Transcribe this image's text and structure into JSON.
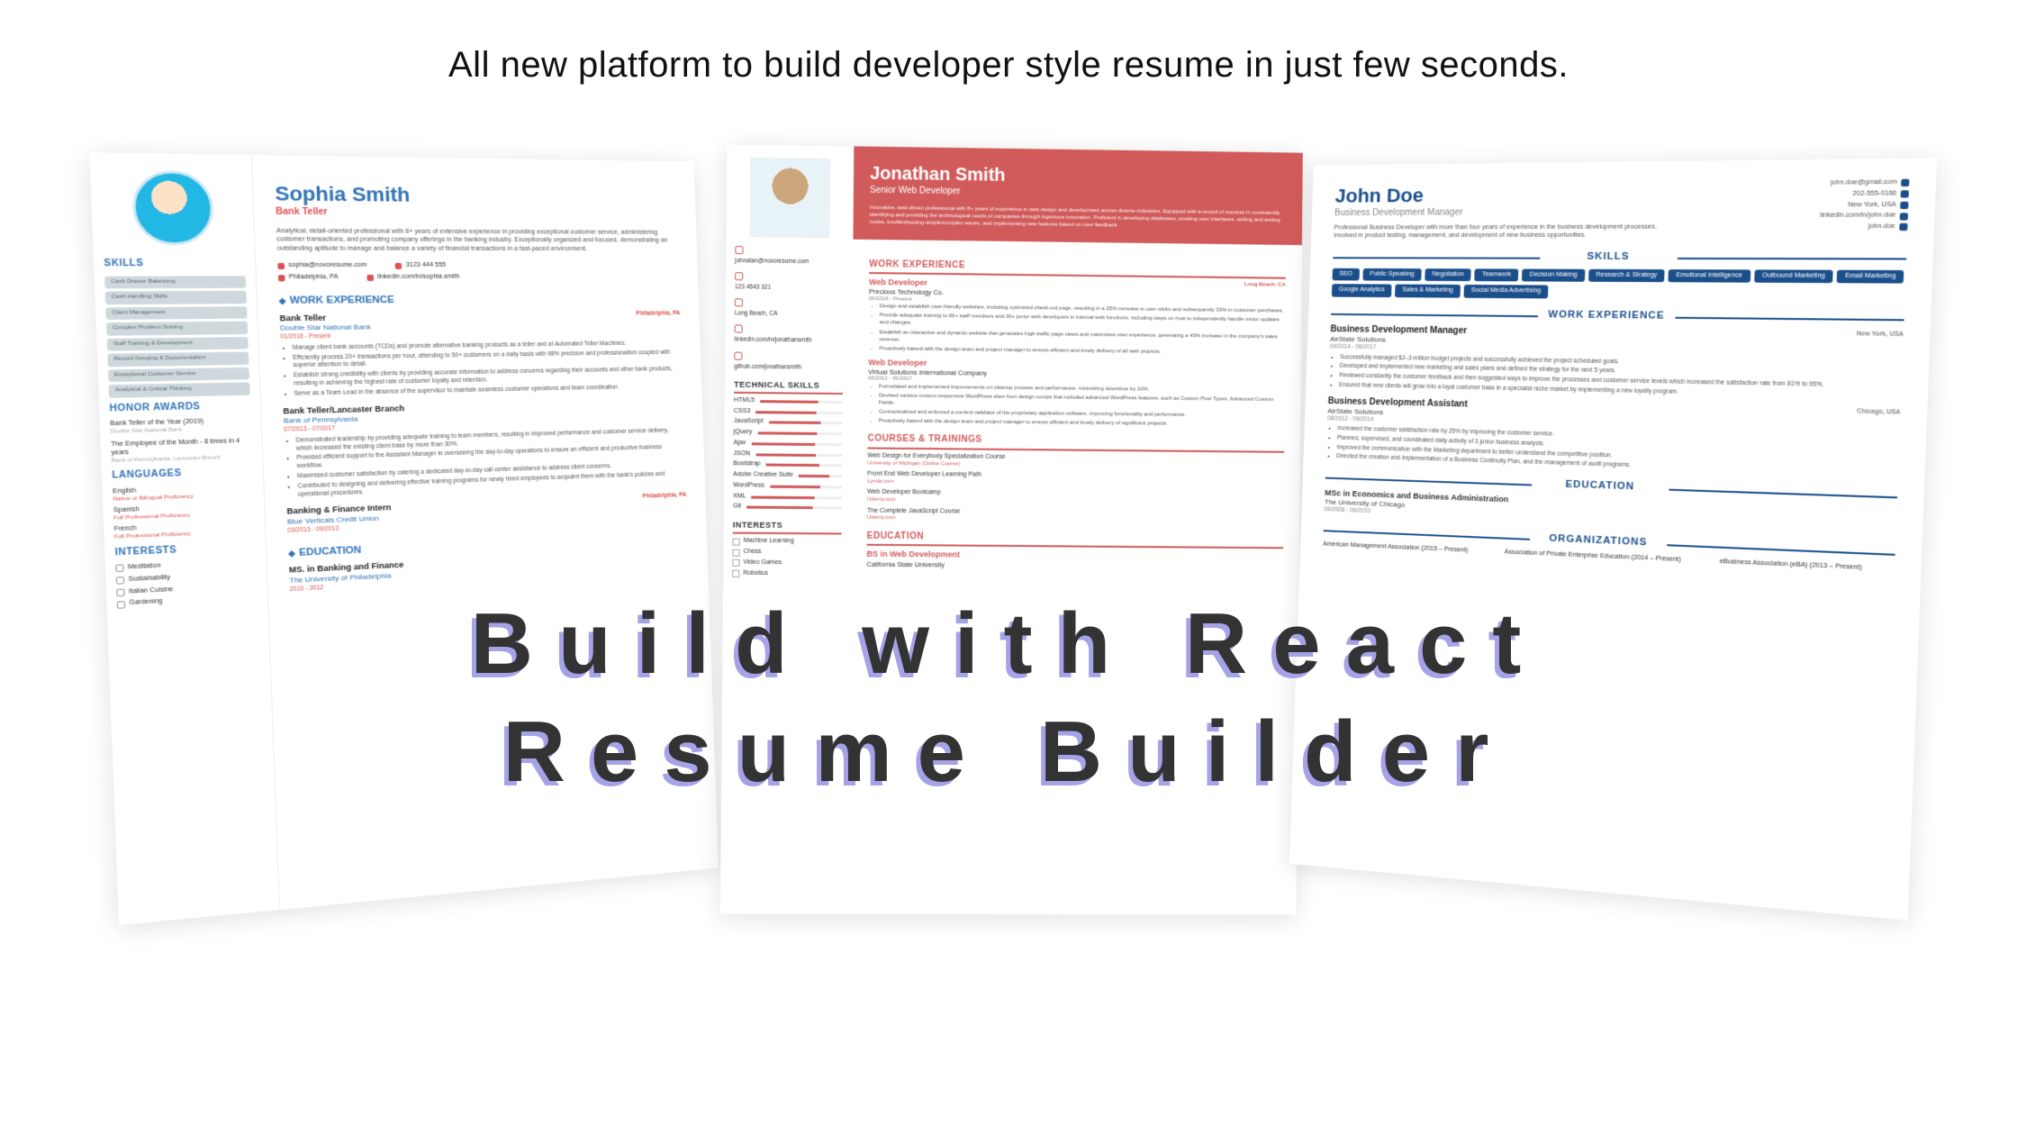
{
  "tagline": "All new platform to build developer style resume in just few seconds.",
  "hero": {
    "line1": "Build with React",
    "line2": "Resume Builder"
  },
  "card1": {
    "name": "Sophia Smith",
    "role": "Bank Teller",
    "summary": "Analytical, detail-oriented professional with 8+ years of extensive experience in providing exceptional customer service, administering customer transactions, and promoting company offerings in the banking industry. Exceptionally organized and focused, demonstrating an outstanding aptitude to manage and balance a variety of financial transactions in a fast-paced environment.",
    "contacts": {
      "email": "sophia@novoresume.com",
      "location": "Philadelphia, PA",
      "phone": "3123 444 555",
      "linkedin": "linkedin.com/in/sophia.smith"
    },
    "sections": {
      "skills_h": "SKILLS",
      "skills": [
        "Cash Drawer Balancing",
        "Cash Handling Skills",
        "Client Management",
        "Complex Problem Solving",
        "Staff Training & Development",
        "Record Keeping & Documentation",
        "Exceptional Customer Service",
        "Analytical & Critical Thinking"
      ],
      "honors_h": "HONOR AWARDS",
      "honors": [
        {
          "t": "Bank Teller of the Year (2019)",
          "s": "Double Star National Bank"
        },
        {
          "t": "The Employee of the Month - 8 times in 4 years",
          "s": "Bank of Pennsylvania, Lancaster Branch"
        }
      ],
      "lang_h": "LANGUAGES",
      "langs": [
        {
          "t": "English",
          "l": "Native or Bilingual Proficiency"
        },
        {
          "t": "Spanish",
          "l": "Full Professional Proficiency"
        },
        {
          "t": "French",
          "l": "Full Professional Proficiency"
        }
      ],
      "int_h": "INTERESTS",
      "interests": [
        "Meditation",
        "Sustainability",
        "Italian Cuisine",
        "Gardening"
      ]
    },
    "work_h": "WORK EXPERIENCE",
    "jobs": [
      {
        "title": "Bank Teller",
        "company": "Double Star National Bank",
        "dates": "01/2018 - Present",
        "loc": "Philadelphia, PA",
        "bullets": [
          "Manage client bank accounts (TCDs) and promote alternative banking products as a teller and at Automated Teller Machines.",
          "Efficiently process 20+ transactions per hour, attending to 50+ customers on a daily basis with 98% precision and professionalism coupled with superior attention to detail.",
          "Establish strong credibility with clients by providing accurate information to address concerns regarding their accounts and other bank products, resulting in achieving the highest rate of customer loyalty and retention.",
          "Serve as a Team Lead in the absence of the supervisor to maintain seamless customer operations and team coordination."
        ]
      },
      {
        "title": "Bank Teller/Lancaster Branch",
        "company": "Bank of Pennsylvania",
        "dates": "07/2013 - 07/2017",
        "bullets": [
          "Demonstrated leadership by providing adequate training to team members, resulting in improved performance and customer service delivery, which increased the existing client base by more than 30%.",
          "Provided efficient support to the Assistant Manager in overseeing the day-to-day operations to ensure an efficient and productive business workflow.",
          "Maximized customer satisfaction by catering a dedicated day-to-day call center assistance to address client concerns.",
          "Contributed to designing and delivering effective training programs for newly hired employees to acquaint them with the bank's policies and operational procedures."
        ]
      },
      {
        "title": "Banking & Finance Intern",
        "company": "Blue Verticals Credit Union",
        "dates": "03/2013 - 09/2013",
        "loc": "Philadelphia, PA",
        "bullets": []
      }
    ],
    "edu_h": "EDUCATION",
    "edu": {
      "deg": "MS. in Banking and Finance",
      "school": "The University of Philadelphia",
      "dates": "2010 - 2012"
    }
  },
  "card2": {
    "name": "Jonathan Smith",
    "role": "Senior Web Developer",
    "summary": "Innovative, task-driven professional with 8+ years of experience in web design and development across diverse industries. Equipped with a record of success in consistently identifying and providing the technological needs of companies through ingenious innovation. Proficient in developing databases, creating user interfaces, writing and testing codes, troubleshooting simple/complex issues, and implementing new features based on user feedback.",
    "contacts": {
      "email": "johnatan@novoresume.com",
      "phone": "123 4543 321",
      "location": "Long Beach, CA",
      "linkedin": "linkedin.com/in/jonathansmith",
      "github": "github.com/jonathansmith"
    },
    "tech_h": "TECHNICAL SKILLS",
    "tech": [
      "HTML5",
      "CSS3",
      "JavaScript",
      "jQuery",
      "Ajax",
      "JSON",
      "Bootstrap",
      "Adobe Creative Suite",
      "WordPress",
      "XML",
      "Git"
    ],
    "int_h": "INTERESTS",
    "interests": [
      "Machine Learning",
      "Chess",
      "Video Games",
      "Robotics"
    ],
    "work_h": "WORK EXPERIENCE",
    "jobs": [
      {
        "title": "Web Developer",
        "company": "Precious Technology Co.",
        "dates": "06/2018 - Present",
        "loc": "Long Beach, CA",
        "bullets": [
          "Design and establish user-friendly websites, including optimized check-out page, resulting in a 25% increase in user clicks and subsequently 33% in customer purchases.",
          "Provide adequate training to 60+ staff members and 30+ junior web developers in internal web functions, including steps on how to independently handle minor updates and changes.",
          "Establish an interactive and dynamic website that generates high-traffic page views and maximizes user experience, generating a 45% increase in the company's sales revenue.",
          "Proactively liaised with the design team and project manager to ensure efficient and timely delivery of all web projects."
        ]
      },
      {
        "title": "Web Developer",
        "company": "Virtual Solutions International Company",
        "dates": "06/2012 - 06/2017",
        "bullets": [
          "Formulated and implemented improvements on cleanup process and performance, minimizing downtime by 10%.",
          "Devised various custom responsive WordPress sites from design comps that included advanced WordPress features, such as Custom Post Types, Advanced Custom Fields.",
          "Conceptualized and enforced a content validator of the proprietary application software, improving functionality and performance.",
          "Proactively liaised with the design team and project manager to ensure efficient and timely delivery of significant projects."
        ]
      }
    ],
    "courses_h": "COURSES & TRAININGS",
    "courses": [
      {
        "t": "Web Design for Everybody Specialization Course",
        "s": "University of Michigan (Online Course)"
      },
      {
        "t": "Front End Web Developer Learning Path",
        "s": "Lynda.com"
      },
      {
        "t": "Web Developer Bootcamp",
        "s": "Udemy.com"
      },
      {
        "t": "The Complete JavaScript Course",
        "s": "Udemy.com"
      }
    ],
    "edu_h": "EDUCATION",
    "edu": {
      "deg": "BS in Web Development",
      "school": "California State University"
    }
  },
  "card3": {
    "name": "John Doe",
    "role": "Business Development Manager",
    "summary": "Professional Business Developer with more than four years of experience in the business development processes. Involved in product testing, management, and development of new business opportunities.",
    "contacts": {
      "email": "john.doe@gmail.com",
      "phone": "202-555-0166",
      "location": "New York, USA",
      "linkedin": "linkedin.com/in/john.doe",
      "skype": "john.doe"
    },
    "skills_h": "SKILLS",
    "skills": [
      "SEO",
      "Public Speaking",
      "Negotiation",
      "Teamwork",
      "Decision Making",
      "Research & Strategy",
      "Emotional Intelligence",
      "Outbound Marketing",
      "Email Marketing",
      "Google Analytics",
      "Sales & Marketing",
      "Social Media Advertising"
    ],
    "work_h": "WORK EXPERIENCE",
    "jobs": [
      {
        "title": "Business Development Manager",
        "company": "AirState Solutions",
        "dates": "09/2014 - 06/2017",
        "loc": "New York, USA",
        "bullets": [
          "Successfully managed $2–3 million budget projects and successfully achieved the project scheduled goals.",
          "Developed and implemented new marketing and sales plans and defined the strategy for the next 5 years.",
          "Reviewed constantly the customer feedback and then suggested ways to improve the processes and customer service levels which increased the satisfaction rate from 81% to 95%.",
          "Ensured that new clients will grow into a loyal customer base in a specialist niche market by implementing a new loyalty program."
        ]
      },
      {
        "title": "Business Development Assistant",
        "company": "AirState Solutions",
        "dates": "08/2012 - 09/2014",
        "loc": "Chicago, USA",
        "bullets": [
          "Increased the customer satisfaction rate by 25% by improving the customer service.",
          "Planned, supervised, and coordinated daily activity of 3 junior business analysts.",
          "Improved the communication with the Marketing department to better understand the competitive position.",
          "Directed the creation and implementation of a Business Continuity Plan, and the management of audit programs."
        ]
      }
    ],
    "edu_h": "EDUCATION",
    "edu": {
      "deg": "MSc in Economics and Business Administration",
      "school": "The University of Chicago",
      "dates": "09/2008 - 06/2010"
    },
    "org_h": "ORGANIZATIONS",
    "orgs": [
      "American Management Association (2015 – Present)",
      "Association of Private Enterprise Education (2014 – Present)",
      "eBusiness Association (eBA) (2013 – Present)"
    ]
  }
}
